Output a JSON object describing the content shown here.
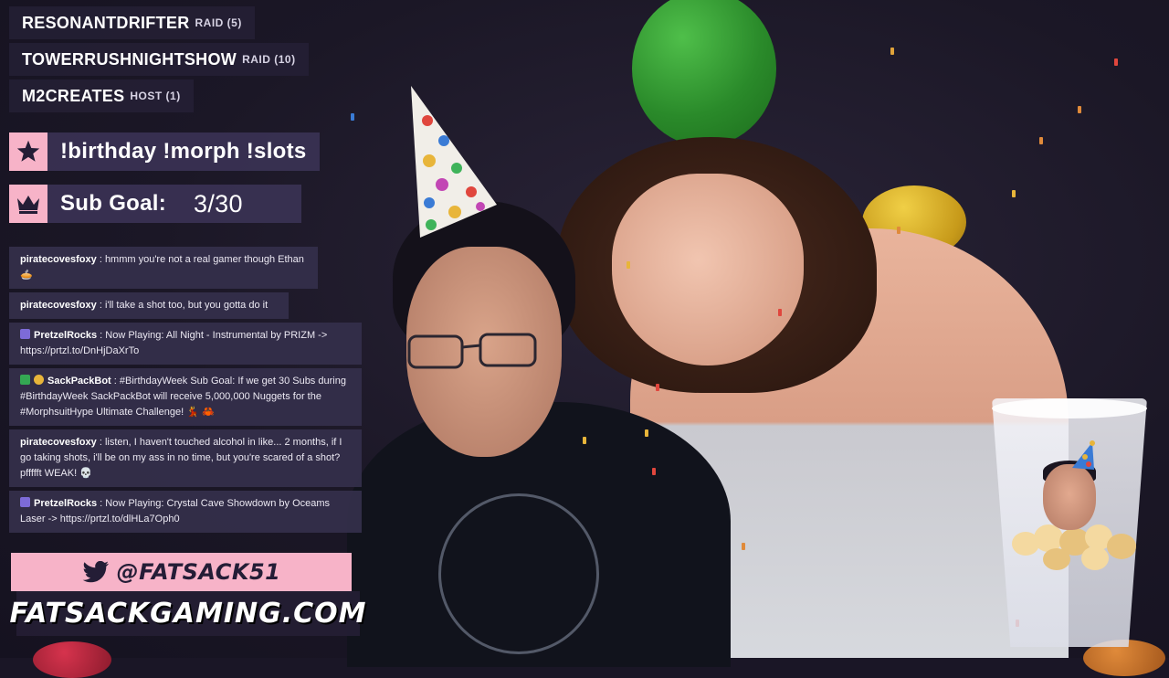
{
  "events": [
    {
      "name": "RESONANTDRIFTER",
      "kind": "RAID (5)"
    },
    {
      "name": "TOWERRUSHNIGHTSHOW",
      "kind": "RAID (10)"
    },
    {
      "name": "M2CREATES",
      "kind": "HOST (1)"
    }
  ],
  "commands": {
    "icon": "star-icon",
    "text": "!birthday !morph !slots"
  },
  "sub_goal": {
    "icon": "crown-icon",
    "label": "Sub Goal:",
    "value": "3/30"
  },
  "chat": [
    {
      "user": "piratecovesfoxy",
      "sep": " : ",
      "text": "hmmm you're not a real gamer though Ethan 🥧",
      "badges": []
    },
    {
      "user": "piratecovesfoxy",
      "sep": " : ",
      "text": "i'll take a shot too, but you gotta do it",
      "badges": []
    },
    {
      "user": "PretzelRocks",
      "sep": " : ",
      "text": "Now Playing: All Night - Instrumental by PRIZM -> https://prtzl.to/DnHjDaXrTo",
      "badges": [
        "verified"
      ]
    },
    {
      "user": "SackPackBot",
      "sep": " : ",
      "text": "#BirthdayWeek Sub Goal: If we get 30 Subs during #BirthdayWeek SackPackBot will receive 5,000,000 Nuggets for the #MorphsuitHype Ultimate Challenge! 💃 🦀",
      "badges": [
        "mod",
        "crown"
      ]
    },
    {
      "user": "piratecovesfoxy",
      "sep": " : ",
      "text": "listen, I haven't touched alcohol in like... 2 months, if I go taking shots, i'll be on my ass in no time, but you're scared of a shot? pffffft WEAK! 💀",
      "badges": []
    },
    {
      "user": "PretzelRocks",
      "sep": " : ",
      "text": "Now Playing: Crystal Cave Showdown by Oceams Laser -> https://prtzl.to/dlHLa7Oph0",
      "badges": [
        "verified"
      ]
    }
  ],
  "social": {
    "icon": "twitter-icon",
    "handle": "@FATSACK51",
    "website": "FATSACKGAMING.COM"
  },
  "colors": {
    "accent_pink": "#f7b3c8",
    "panel_dark": "#241d36",
    "panel_purple": "#3a3254"
  }
}
